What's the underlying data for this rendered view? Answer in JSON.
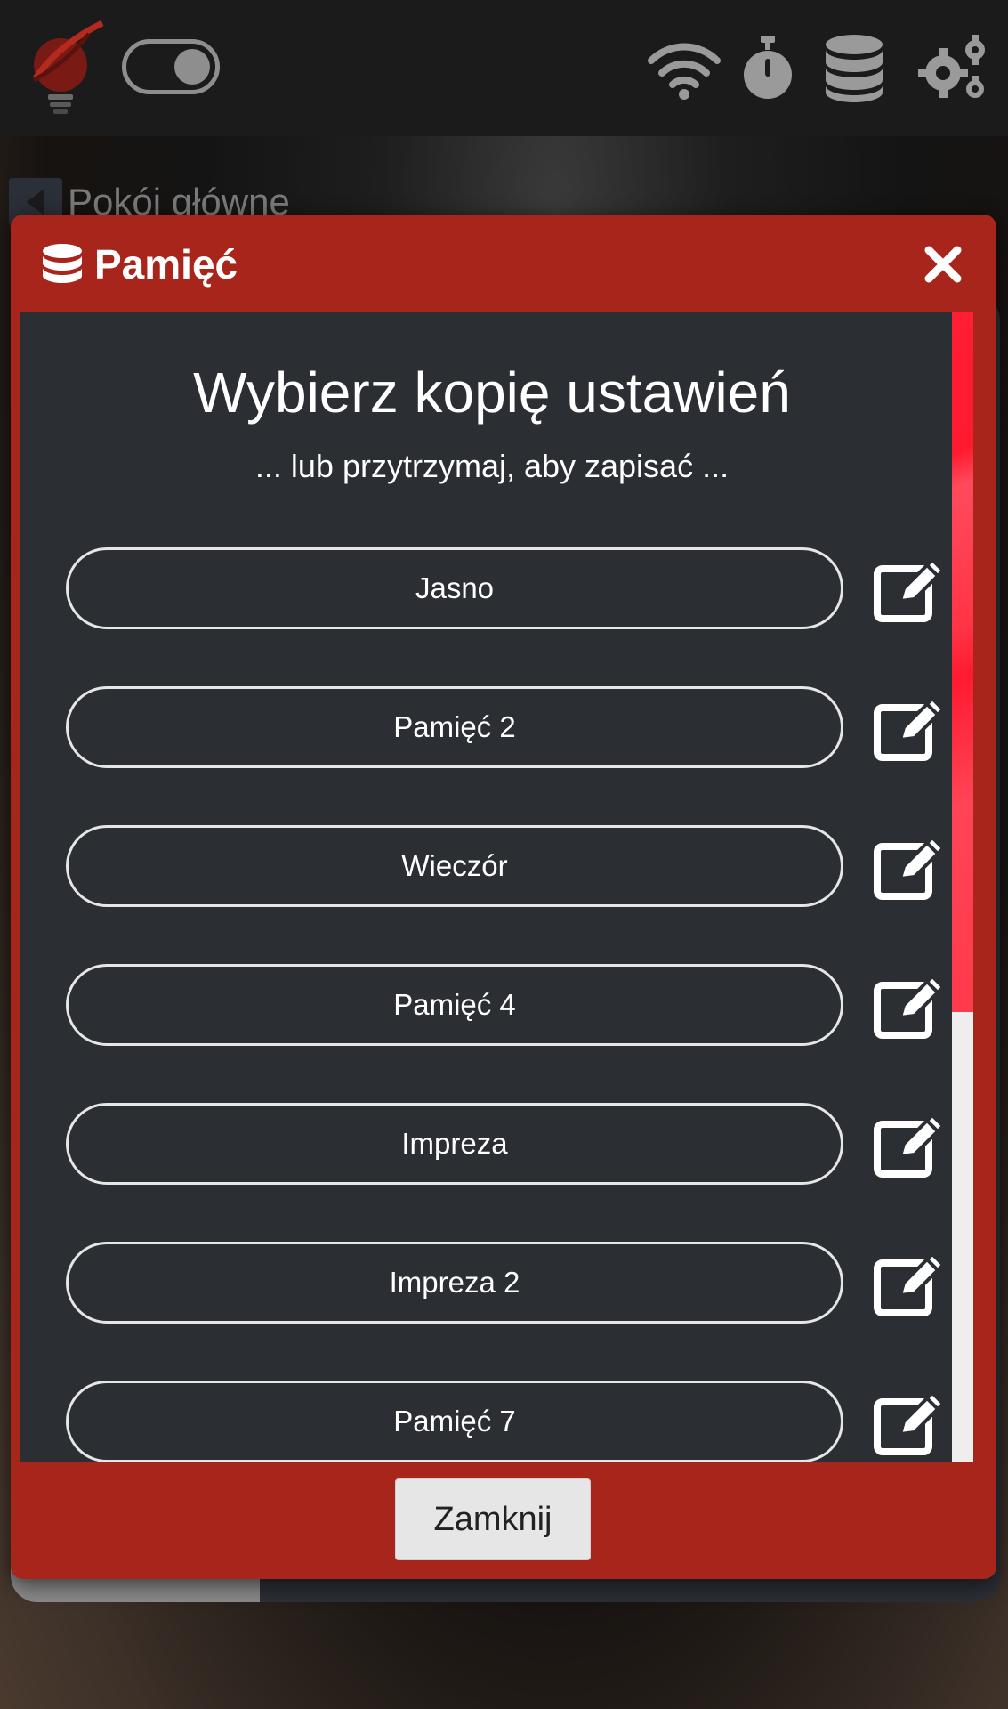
{
  "topbar": {
    "logo_icon": "lightbulb-logo-icon",
    "toggle_state": "on",
    "icons": [
      "wifi-icon",
      "stopwatch-icon",
      "database-icon",
      "gears-icon"
    ]
  },
  "room": {
    "back_icon": "back-arrow-icon",
    "title": "Pokój główne"
  },
  "modal": {
    "title_icon": "database-icon",
    "title": "Pamięć",
    "close_icon": "close-icon",
    "heading": "Wybierz kopię ustawień",
    "subheading": "... lub przytrzymaj, aby zapisać ...",
    "items": [
      {
        "label": "Jasno"
      },
      {
        "label": "Pamięć 2"
      },
      {
        "label": "Wieczór"
      },
      {
        "label": "Pamięć 4"
      },
      {
        "label": "Impreza"
      },
      {
        "label": "Impreza 2"
      },
      {
        "label": "Pamięć 7"
      }
    ],
    "edit_icon": "edit-icon",
    "close_button_label": "Zamknij"
  },
  "colors": {
    "modal_red": "#a8251b",
    "body_dark": "#2b2e33",
    "scrollbar_red": "#ff1a30"
  }
}
